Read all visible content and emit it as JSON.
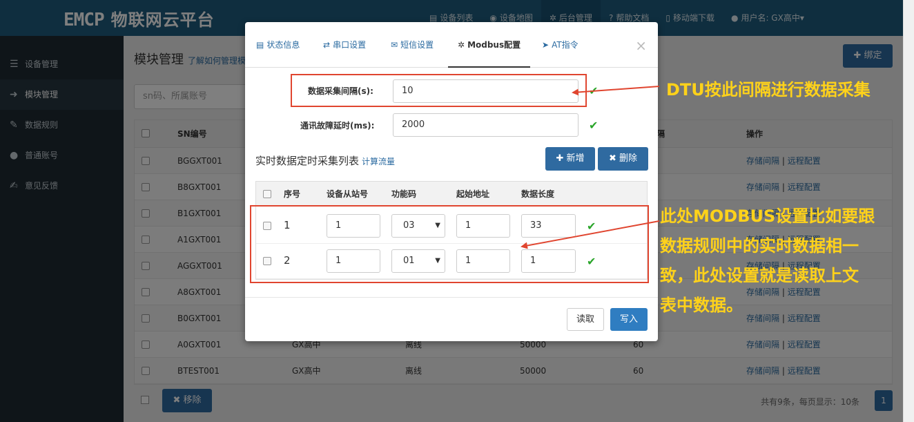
{
  "brand": {
    "logo_mark": "EMCP",
    "logo_text": "物联网云平台"
  },
  "topnav": [
    {
      "icon": "device-list-icon",
      "label": "设备列表"
    },
    {
      "icon": "device-map-icon",
      "label": "设备地图"
    },
    {
      "icon": "gear-icon",
      "label": "后台管理"
    },
    {
      "icon": "help-icon",
      "label": "帮助文档"
    },
    {
      "icon": "mobile-icon",
      "label": "移动端下载"
    },
    {
      "icon": "user-icon",
      "label": "用户名: GX高中▾"
    }
  ],
  "sidebar": {
    "items": [
      {
        "icon": "list-icon",
        "label": "设备管理"
      },
      {
        "icon": "login-icon",
        "label": "模块管理"
      },
      {
        "icon": "pencil-icon",
        "label": "数据规则"
      },
      {
        "icon": "user-icon",
        "label": "普通账号"
      },
      {
        "icon": "edit-icon",
        "label": "意见反馈"
      }
    ]
  },
  "main": {
    "title": "模块管理",
    "help_link": "了解如何管理模",
    "bind_button": "✚ 绑定",
    "search_placeholder": "sn码、所属账号",
    "table": {
      "headers": {
        "sn": "SN编号",
        "interval": "隔",
        "ops": "操作"
      },
      "rows": [
        {
          "sn": "BGGXT001",
          "owner": "",
          "status": "",
          "flow": "",
          "interval": ""
        },
        {
          "sn": "B8GXT001",
          "owner": "",
          "status": "",
          "flow": "",
          "interval": ""
        },
        {
          "sn": "B1GXT001",
          "owner": "",
          "status": "",
          "flow": "",
          "interval": ""
        },
        {
          "sn": "A1GXT001",
          "owner": "",
          "status": "",
          "flow": "",
          "interval": ""
        },
        {
          "sn": "AGGXT001",
          "owner": "",
          "status": "",
          "flow": "",
          "interval": ""
        },
        {
          "sn": "A8GXT001",
          "owner": "",
          "status": "",
          "flow": "",
          "interval": ""
        },
        {
          "sn": "B0GXT001",
          "owner": "",
          "status": "",
          "flow": "",
          "interval": ""
        },
        {
          "sn": "A0GXT001",
          "owner": "GX高中",
          "status": "离线",
          "flow": "50000",
          "interval": "60"
        },
        {
          "sn": "BTEST001",
          "owner": "GX高中",
          "status": "离线",
          "flow": "50000",
          "interval": "60"
        }
      ],
      "ops_store": "存储间隔",
      "ops_sep": "|",
      "ops_remote": "远程配置"
    },
    "remove_button": "✖ 移除",
    "pager_text": "共有9条，每页显示：10条",
    "pager_page": "1"
  },
  "modal": {
    "tabs": [
      {
        "icon": "status-icon",
        "label": "状态信息"
      },
      {
        "icon": "shuffle-icon",
        "label": "串口设置"
      },
      {
        "icon": "envelope-icon",
        "label": "短信设置"
      },
      {
        "icon": "gear-icon",
        "label": "Modbus配置"
      },
      {
        "icon": "send-icon",
        "label": "AT指令"
      }
    ],
    "close": "×",
    "fields": {
      "collect_interval_label": "数据采集间隔(s):",
      "collect_interval_value": "10",
      "fault_delay_label": "通讯故障延时(ms):",
      "fault_delay_value": "2000"
    },
    "list_title": "实时数据定时采集列表",
    "calc_link": "计算流量",
    "add_button": "✚ 新增",
    "delete_button": "✖ 删除",
    "table": {
      "headers": [
        "序号",
        "设备从站号",
        "功能码",
        "起始地址",
        "数据长度"
      ],
      "rows": [
        {
          "no": "1",
          "slave": "1",
          "func": "03",
          "start": "1",
          "length": "33"
        },
        {
          "no": "2",
          "slave": "1",
          "func": "01",
          "start": "1",
          "length": "1"
        }
      ]
    },
    "read_button": "读取",
    "write_button": "写入"
  },
  "annotations": {
    "note1": "DTU按此间隔进行数据采集",
    "note2_lines": [
      "此处MODBUS设置比如要跟",
      "数据规则中的实时数据相一",
      "致，此处设置就是读取上文",
      "表中数据。"
    ],
    "color_box": "#e0452f",
    "color_text": "#ffd21a"
  }
}
